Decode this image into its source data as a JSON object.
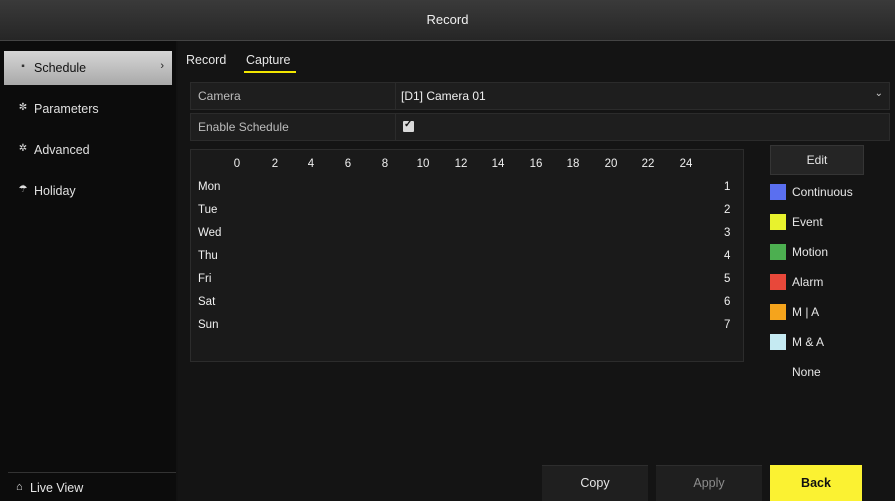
{
  "window": {
    "title": "Record"
  },
  "sidebar": {
    "items": [
      {
        "label": "Schedule",
        "icon": "schedule-icon"
      },
      {
        "label": "Parameters",
        "icon": "gear-icon"
      },
      {
        "label": "Advanced",
        "icon": "advanced-icon"
      },
      {
        "label": "Holiday",
        "icon": "umbrella-icon"
      }
    ],
    "live_view": {
      "label": "Live View",
      "icon": "home-icon"
    }
  },
  "tabs": [
    {
      "label": "Record"
    },
    {
      "label": "Capture"
    }
  ],
  "form": {
    "camera": {
      "label": "Camera",
      "value": "[D1] Camera 01"
    },
    "enable_schedule": {
      "label": "Enable Schedule",
      "checked": true
    }
  },
  "schedule": {
    "hours": [
      "0",
      "2",
      "4",
      "6",
      "8",
      "10",
      "12",
      "14",
      "16",
      "18",
      "20",
      "22",
      "24"
    ],
    "days": [
      {
        "name": "Mon",
        "num": "1"
      },
      {
        "name": "Tue",
        "num": "2"
      },
      {
        "name": "Wed",
        "num": "3"
      },
      {
        "name": "Thu",
        "num": "4"
      },
      {
        "name": "Fri",
        "num": "5"
      },
      {
        "name": "Sat",
        "num": "6"
      },
      {
        "name": "Sun",
        "num": "7"
      }
    ]
  },
  "edit_label": "Edit",
  "legend": [
    {
      "name": "Continuous",
      "color": "#5a6ff0"
    },
    {
      "name": "Event",
      "color": "#e8f22d"
    },
    {
      "name": "Motion",
      "color": "#4caf50"
    },
    {
      "name": "Alarm",
      "color": "#e8483a"
    },
    {
      "name": "M | A",
      "color": "#f5a41c"
    },
    {
      "name": "M & A",
      "color": "#c5eaf2"
    },
    {
      "name": "None",
      "color": "#141414"
    }
  ],
  "buttons": {
    "copy": "Copy",
    "apply": "Apply",
    "back": "Back"
  },
  "colors": {
    "accent": "#fbf232",
    "active_tab_underline": "#f2e600"
  }
}
